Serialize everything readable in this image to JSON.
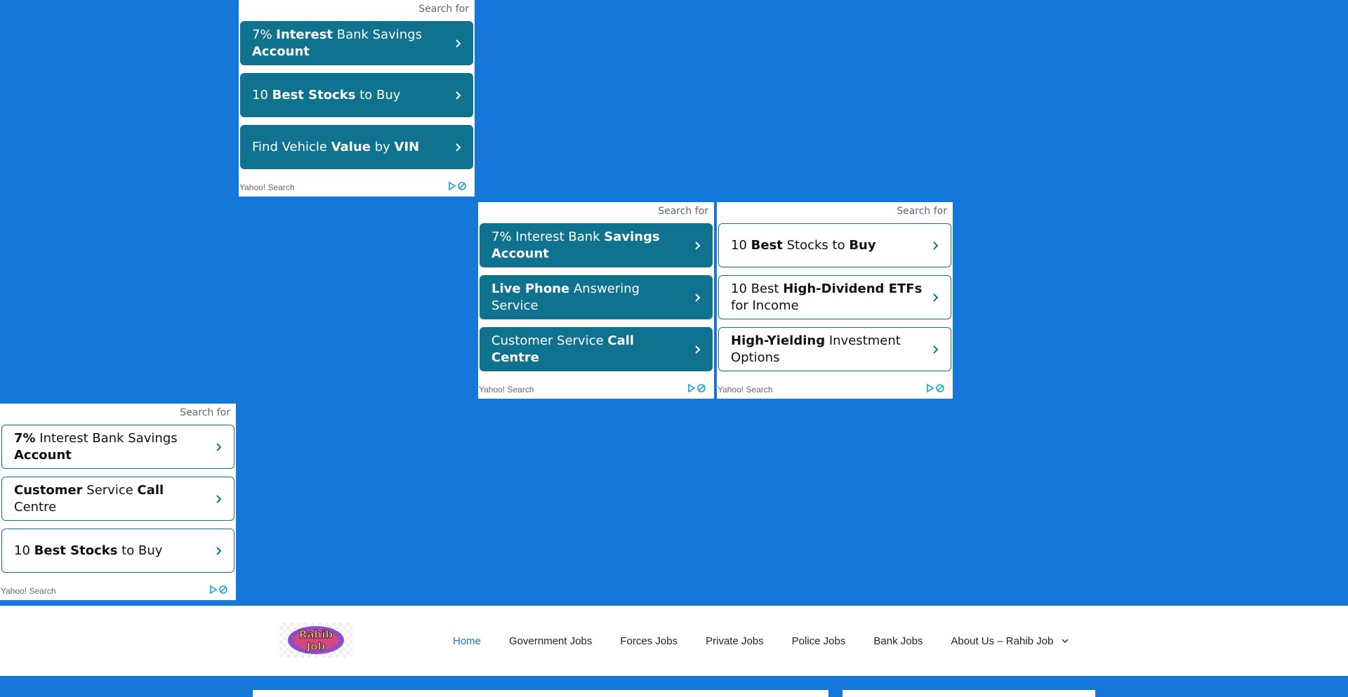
{
  "ads": [
    {
      "search_for": "Search for",
      "items": [
        {
          "parts": [
            {
              "t": "7% "
            },
            {
              "t": "Interest",
              "b": true
            },
            {
              "t": " Bank Savings "
            },
            {
              "t": "Account",
              "b": true
            }
          ]
        },
        {
          "parts": [
            {
              "t": "10 "
            },
            {
              "t": "Best Stocks",
              "b": true
            },
            {
              "t": " to Buy"
            }
          ]
        },
        {
          "parts": [
            {
              "t": "Find Vehicle "
            },
            {
              "t": "Value",
              "b": true
            },
            {
              "t": " by "
            },
            {
              "t": "VIN",
              "b": true
            }
          ]
        }
      ],
      "footer": "Yahoo! Search"
    },
    {
      "search_for": "Search for",
      "items": [
        {
          "parts": [
            {
              "t": "7% Interest Bank "
            },
            {
              "t": "Savings Account",
              "b": true
            }
          ]
        },
        {
          "parts": [
            {
              "t": "Live Phone",
              "b": true
            },
            {
              "t": " Answering Service"
            }
          ]
        },
        {
          "parts": [
            {
              "t": "Customer Service "
            },
            {
              "t": "Call Centre",
              "b": true
            }
          ]
        }
      ],
      "footer": "Yahoo! Search"
    },
    {
      "search_for": "Search for",
      "items": [
        {
          "parts": [
            {
              "t": "10 "
            },
            {
              "t": "Best",
              "b": true
            },
            {
              "t": " Stocks to "
            },
            {
              "t": "Buy",
              "b": true
            }
          ]
        },
        {
          "parts": [
            {
              "t": "10 Best "
            },
            {
              "t": "High-Dividend ETFs",
              "b": true
            },
            {
              "t": " for Income"
            }
          ]
        },
        {
          "parts": [
            {
              "t": "High-Yielding",
              "b": true
            },
            {
              "t": " Investment Options"
            }
          ]
        }
      ],
      "footer": "Yahoo! Search"
    },
    {
      "search_for": "Search for",
      "items": [
        {
          "parts": [
            {
              "t": "7%",
              "b": true
            },
            {
              "t": " Interest Bank Savings "
            },
            {
              "t": "Account",
              "b": true
            }
          ]
        },
        {
          "parts": [
            {
              "t": "Customer",
              "b": true
            },
            {
              "t": " Service "
            },
            {
              "t": "Call",
              "b": true
            },
            {
              "t": " Centre"
            }
          ]
        },
        {
          "parts": [
            {
              "t": "10 "
            },
            {
              "t": "Best Stocks",
              "b": true
            },
            {
              "t": " to Buy"
            }
          ]
        }
      ],
      "footer": "Yahoo! Search"
    }
  ],
  "header": {
    "logo_text": "Rahib Job",
    "nav": [
      {
        "label": "Home",
        "active": true
      },
      {
        "label": "Government Jobs"
      },
      {
        "label": "Forces Jobs"
      },
      {
        "label": "Private Jobs"
      },
      {
        "label": "Police Jobs"
      },
      {
        "label": "Bank Jobs"
      },
      {
        "label": "About Us – Rahib Job",
        "has_dropdown": true
      }
    ]
  },
  "colors": {
    "page_background": "#1477d9",
    "ad_teal": "#0f7390",
    "nav_active": "#1e72bd"
  }
}
